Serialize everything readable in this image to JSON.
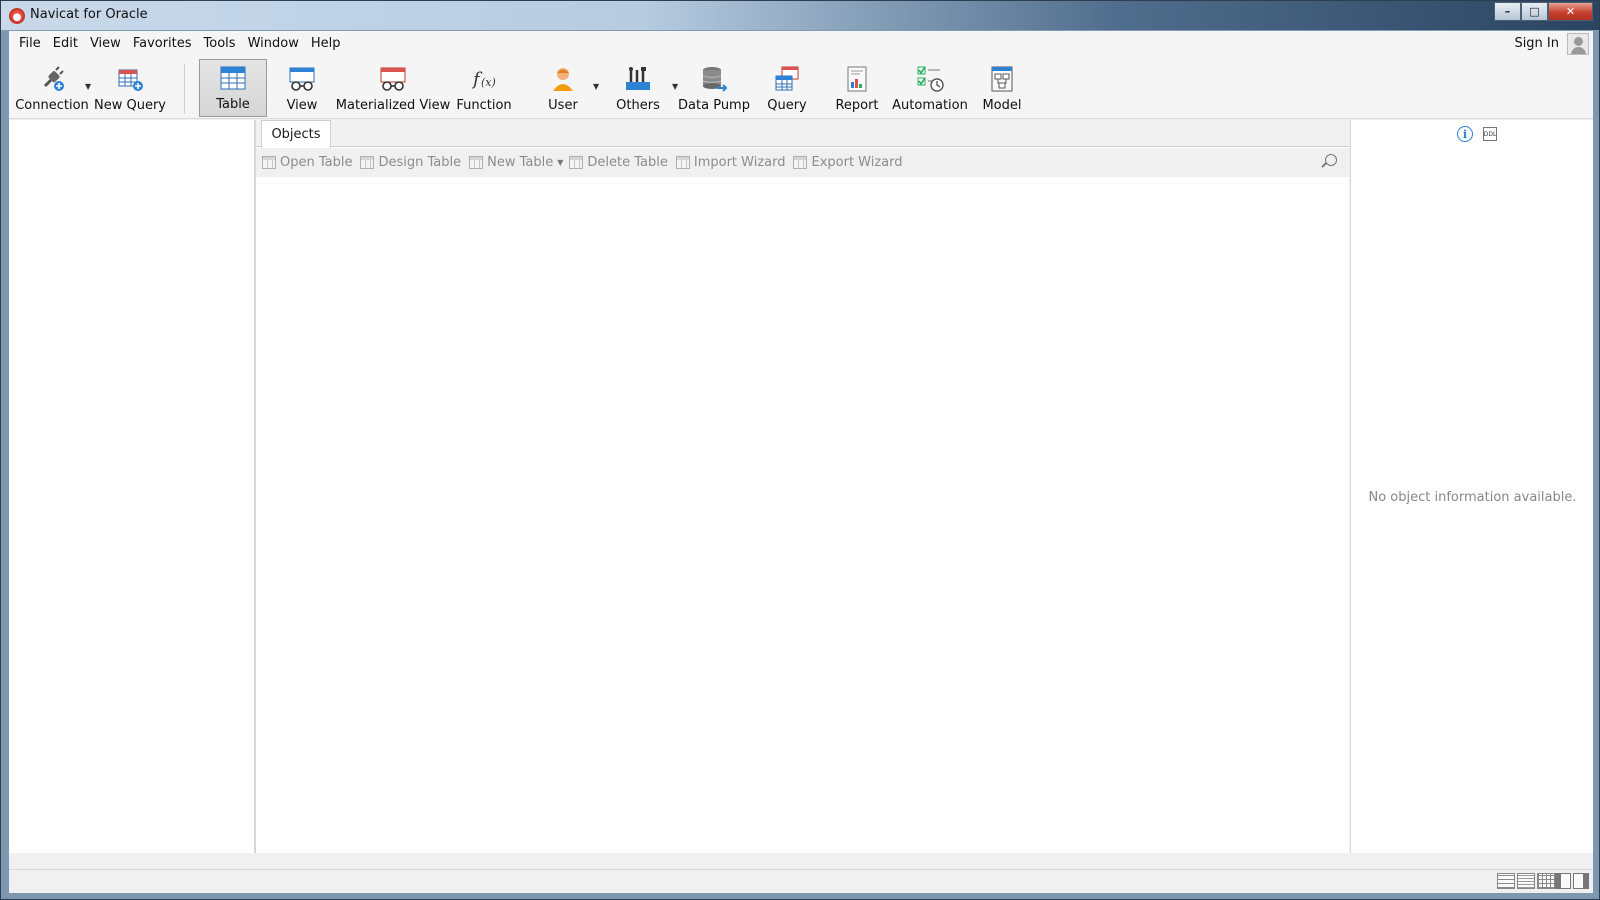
{
  "window": {
    "title": "Navicat for Oracle",
    "controls": {
      "minimize": "–",
      "maximize": "□",
      "close": "✕"
    }
  },
  "menu": {
    "items": [
      "File",
      "Edit",
      "View",
      "Favorites",
      "Tools",
      "Window",
      "Help"
    ],
    "sign_in": "Sign In"
  },
  "toolbar": {
    "buttons": [
      {
        "label": "Connection",
        "icon": "connection-plug-icon",
        "has_dropdown": true
      },
      {
        "label": "New Query",
        "icon": "new-query-icon"
      },
      {
        "label": "Table",
        "icon": "table-icon",
        "active": true
      },
      {
        "label": "View",
        "icon": "view-icon"
      },
      {
        "label": "Materialized View",
        "icon": "materialized-view-icon"
      },
      {
        "label": "Function",
        "icon": "function-icon"
      },
      {
        "label": "User",
        "icon": "user-icon",
        "has_dropdown": true
      },
      {
        "label": "Others",
        "icon": "others-tools-icon",
        "has_dropdown": true
      },
      {
        "label": "Data Pump",
        "icon": "data-pump-icon"
      },
      {
        "label": "Query",
        "icon": "query-icon"
      },
      {
        "label": "Report",
        "icon": "report-icon"
      },
      {
        "label": "Automation",
        "icon": "automation-icon"
      },
      {
        "label": "Model",
        "icon": "model-icon"
      }
    ]
  },
  "objects": {
    "tab": "Objects",
    "actions": [
      {
        "label": "Open Table",
        "icon": "open-table-icon"
      },
      {
        "label": "Design Table",
        "icon": "design-table-icon"
      },
      {
        "label": "New Table",
        "icon": "new-table-icon",
        "has_dropdown": true
      },
      {
        "label": "Delete Table",
        "icon": "delete-table-icon"
      },
      {
        "label": "Import Wizard",
        "icon": "import-wizard-icon"
      },
      {
        "label": "Export Wizard",
        "icon": "export-wizard-icon"
      }
    ]
  },
  "info_pane": {
    "message": "No object information available.",
    "info_glyph": "i",
    "ddl_glyph": "DDL"
  },
  "colors": {
    "accent_blue": "#2d82d6",
    "brand_red": "#c0392b",
    "disabled_text": "#8c8c8c"
  }
}
